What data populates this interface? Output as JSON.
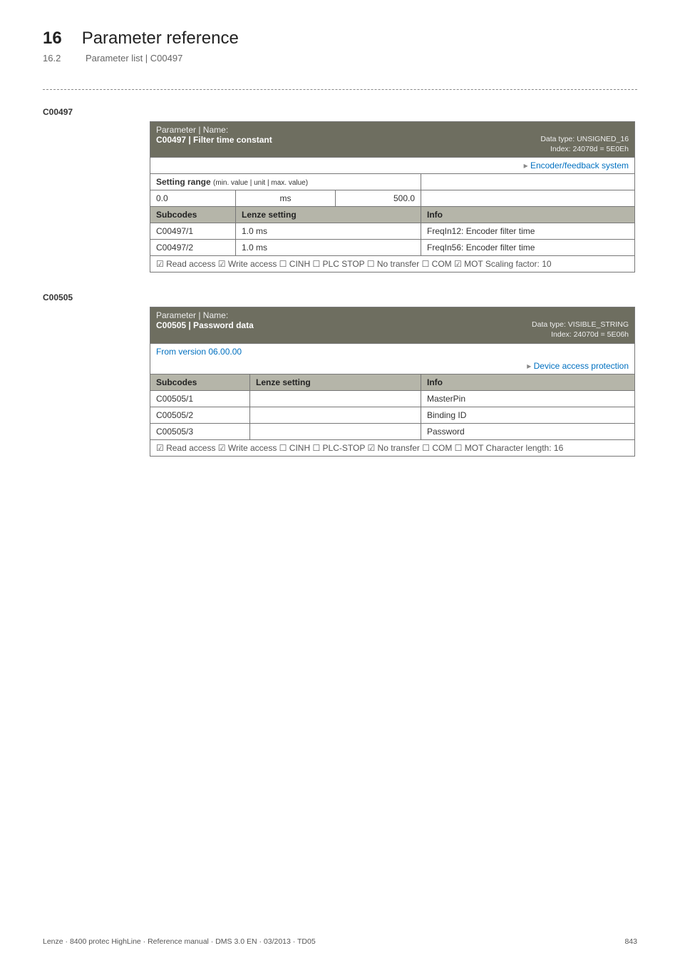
{
  "header": {
    "num": "16",
    "title": "Parameter reference",
    "sub_num": "16.2",
    "sub_title": "Parameter list | C00497"
  },
  "c497": {
    "code_label": "C00497",
    "pn_label": "Parameter | Name:",
    "pn_value": "C00497 | Filter time constant",
    "dtype": "Data type: UNSIGNED_16",
    "index": "Index: 24078d = 5E0Eh",
    "link": "Encoder/feedback system",
    "link_tri": "▸",
    "setting_range": "Setting range",
    "setting_range_sub": "(min. value | unit | max. value)",
    "min": "0.0",
    "unit": "ms",
    "max": "500.0",
    "subcodes_h": "Subcodes",
    "lenze_h": "Lenze setting",
    "info_h": "Info",
    "rows": [
      {
        "sc": "C00497/1",
        "lenze": "1.0 ms",
        "info": "FreqIn12: Encoder filter time"
      },
      {
        "sc": "C00497/2",
        "lenze": "1.0 ms",
        "info": "FreqIn56: Encoder filter time"
      }
    ],
    "meta": "☑ Read access   ☑ Write access   ☐ CINH   ☐ PLC STOP   ☐ No transfer   ☐ COM   ☑ MOT     Scaling factor: 10"
  },
  "c505": {
    "code_label": "C00505",
    "pn_label": "Parameter | Name:",
    "pn_value": "C00505 | Password data",
    "dtype": "Data type: VISIBLE_STRING",
    "index": "Index: 24070d = 5E06h",
    "from_ver": "From version 06.00.00",
    "link": "Device access protection",
    "link_tri": "▸",
    "subcodes_h": "Subcodes",
    "lenze_h": "Lenze setting",
    "info_h": "Info",
    "rows": [
      {
        "sc": "C00505/1",
        "lenze": "",
        "info": "MasterPin"
      },
      {
        "sc": "C00505/2",
        "lenze": "",
        "info": "Binding ID"
      },
      {
        "sc": "C00505/3",
        "lenze": "",
        "info": "Password"
      }
    ],
    "meta": "☑ Read access   ☑ Write access   ☐ CINH   ☐ PLC-STOP   ☑ No transfer   ☐ COM   ☐ MOT     Character length: 16"
  },
  "footer": {
    "left": "Lenze · 8400 protec HighLine · Reference manual · DMS 3.0 EN · 03/2013 · TD05",
    "right": "843"
  }
}
